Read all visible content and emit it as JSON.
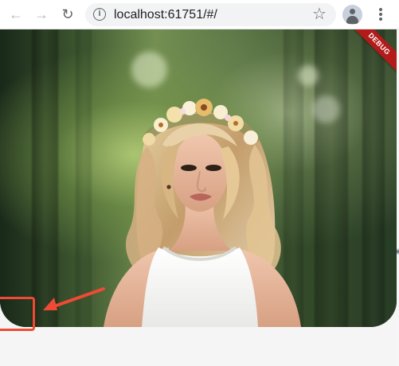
{
  "browser": {
    "url": "localhost:61751/#/",
    "icons": {
      "back": "back-arrow-icon",
      "forward": "forward-arrow-icon",
      "reload": "reload-icon",
      "site_info": "info-icon",
      "bookmark": "star-icon",
      "profile": "profile-icon",
      "menu": "more-vertical-icon"
    }
  },
  "app": {
    "debug_label": "DEBUG",
    "image": {
      "subject": "woman-with-flower-crown-portrait"
    }
  },
  "annotation": {
    "highlight_color": "#ef4a35",
    "arrow_color": "#ef4a35"
  },
  "colors": {
    "debug_banner": "#b31b1b",
    "toolbar_background": "#ffffff",
    "omnibox_background": "#f1f3f4"
  }
}
